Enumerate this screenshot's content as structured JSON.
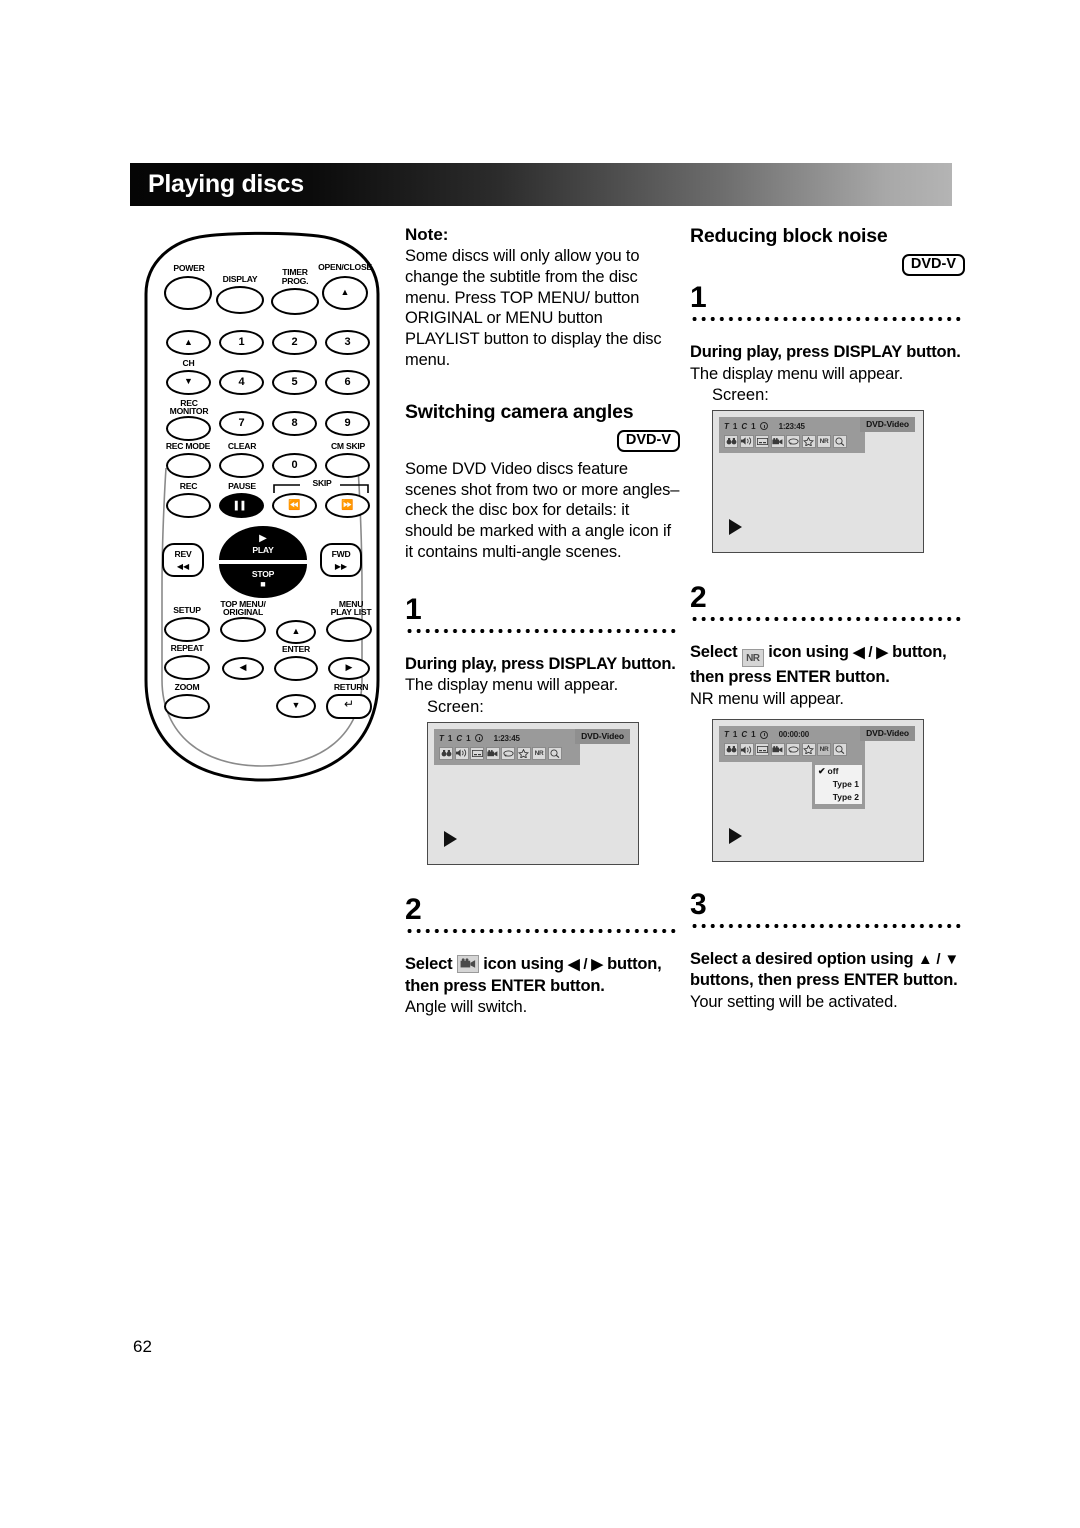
{
  "header": {
    "title": "Playing discs"
  },
  "page_number": "62",
  "remote": {
    "labels": {
      "power": "POWER",
      "display": "DISPLAY",
      "timer_prog_l1": "TIMER",
      "timer_prog_l2": "PROG.",
      "open_close": "OPEN/CLOSE",
      "ch": "CH",
      "rec_monitor_l1": "REC",
      "rec_monitor_l2": "MONITOR",
      "rec_mode": "REC MODE",
      "clear": "CLEAR",
      "cm_skip": "CM SKIP",
      "rec": "REC",
      "pause": "PAUSE",
      "skip": "SKIP",
      "rev": "REV",
      "fwd": "FWD",
      "play": "PLAY",
      "stop": "STOP",
      "setup": "SETUP",
      "top_menu_l1": "TOP MENU/",
      "top_menu_l2": "ORIGINAL",
      "menu_l1": "MENU",
      "menu_l2": "PLAY LIST",
      "repeat": "REPEAT",
      "enter": "ENTER",
      "zoom": "ZOOM",
      "return": "RETURN"
    },
    "numbers": [
      "1",
      "2",
      "3",
      "4",
      "5",
      "6",
      "7",
      "8",
      "9",
      "0"
    ],
    "glyphs": {
      "eject": "▲",
      "ch_up": "▲",
      "ch_down": "▼",
      "pause": "❙❙",
      "skip_prev": "⏮",
      "skip_next": "⏭",
      "rev": "◀◀",
      "fwd": "▶▶",
      "play": "▶",
      "stop": "■",
      "nav_up": "▲",
      "nav_down": "▼",
      "nav_left": "◀",
      "nav_right": "▶",
      "return": "↵"
    }
  },
  "note": {
    "label": "Note:",
    "text": "Some discs will only allow you to change the subtitle from the disc menu. Press TOP MENU/ button ORIGINAL or MENU button PLAYLIST button to display the disc menu."
  },
  "camera_angles": {
    "heading": "Switching camera angles",
    "badge": "DVD-V",
    "intro": "Some DVD Video discs feature scenes shot from two or more angles–check the disc box for details: it should be marked with a angle icon if it contains multi-angle scenes.",
    "steps": [
      {
        "number": "1",
        "bold_html": "During play, press DISPLAY button.",
        "note": "The display menu will appear.",
        "screen_label": "Screen:"
      },
      {
        "number": "2",
        "bold_pre": "Select",
        "bold_post_a": "icon using",
        "bold_arrows": "◀ / ▶",
        "bold_post_b": "button, then press ENTER button.",
        "note": "Angle will switch.",
        "icon": "camera-angle-icon"
      }
    ]
  },
  "block_noise": {
    "heading": "Reducing block noise",
    "badge": "DVD-V",
    "steps": [
      {
        "number": "1",
        "bold_html": "During play, press DISPLAY button.",
        "note": "The display menu will appear.",
        "screen_label": "Screen:"
      },
      {
        "number": "2",
        "bold_pre": "Select",
        "bold_post_a": "icon using",
        "bold_arrows": "◀ / ▶",
        "bold_post_b": "button, then press ENTER button.",
        "note": "NR menu will appear.",
        "icon": "nr-icon",
        "icon_text": "NR"
      },
      {
        "number": "3",
        "bold_line1": "Select a desired option using",
        "bold_arrows": "▲ / ▼",
        "bold_line2": "buttons, then press",
        "bold_line3": "ENTER button.",
        "note": "Your setting will be activated."
      }
    ]
  },
  "osd": {
    "title_letter": "T",
    "title_value": "1",
    "chapter_letter": "C",
    "chapter_value": "1",
    "timecode_play": "1:23:45",
    "timecode_zero": "00:00:00",
    "disc_type": "DVD-Video",
    "icons": [
      "search-icon",
      "audio-icon",
      "subtitle-icon",
      "camera-angle-icon",
      "repeat-icon",
      "marker-icon",
      "nr-icon",
      "zoom-icon"
    ],
    "nr_menu": {
      "options": [
        "off",
        "Type 1",
        "Type 2"
      ],
      "selected": "off",
      "check": "✔"
    }
  }
}
